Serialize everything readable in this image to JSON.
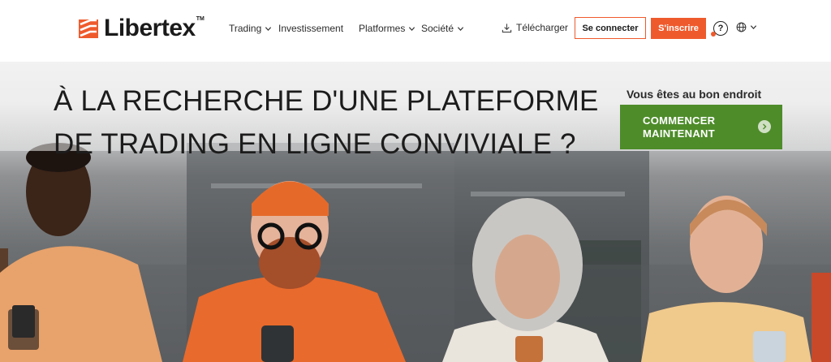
{
  "brand": {
    "name": "Libertex",
    "tm": "TM",
    "accent": "#ef5a2c",
    "cta_color": "#4e8c2a"
  },
  "nav": {
    "items": [
      {
        "label": "Trading",
        "has_dropdown": true
      },
      {
        "label": "Investissement",
        "has_dropdown": false
      },
      {
        "label": "Platformes",
        "has_dropdown": true
      },
      {
        "label": "Société",
        "has_dropdown": true
      }
    ],
    "download": "Télécharger",
    "login": "Se connecter",
    "signup": "S'inscrire",
    "help": "?"
  },
  "hero": {
    "title_line1": "À LA RECHERCHE D'UNE PLATEFORME",
    "title_line2": "DE TRADING EN LIGNE CONVIVIALE ?",
    "cta_caption": "Vous êtes au bon endroit",
    "cta_line1": "COMMENCER",
    "cta_line2": "MAINTENANT"
  }
}
